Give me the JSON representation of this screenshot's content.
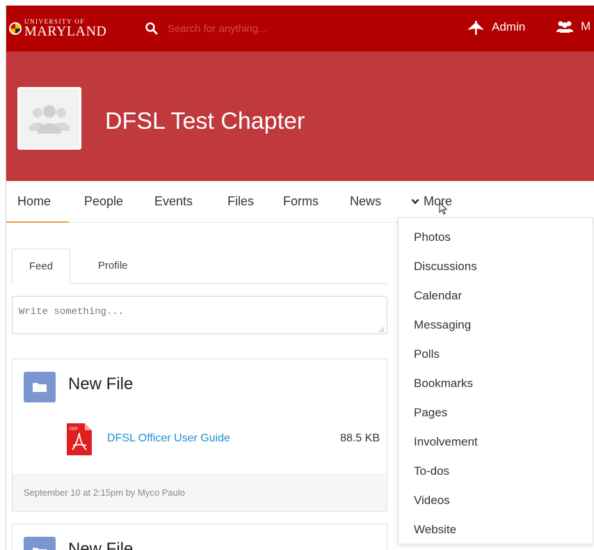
{
  "topbar": {
    "logo": {
      "line1": "UNIVERSITY OF",
      "line2": "MARYLAND"
    },
    "search_placeholder": "Search for anything...",
    "admin_label": "Admin",
    "members_label": "M",
    "bg_color": "#b30000"
  },
  "banner": {
    "title": "DFSL Test Chapter",
    "bg_color": "#c0393c"
  },
  "nav": {
    "tabs": [
      {
        "label": "Home",
        "active": true
      },
      {
        "label": "People"
      },
      {
        "label": "Events"
      },
      {
        "label": "Files"
      },
      {
        "label": "Forms"
      },
      {
        "label": "News"
      }
    ],
    "more_label": "More",
    "accent_color": "#e6a23c"
  },
  "feed": {
    "tabs": [
      {
        "label": "Feed",
        "active": true
      },
      {
        "label": "Profile"
      }
    ],
    "compose_placeholder": "Write something..."
  },
  "posts": [
    {
      "title": "New File",
      "file": {
        "name": "DFSL Officer User Guide",
        "size": "88.5 KB",
        "icon": "pdf-icon"
      },
      "meta": "September 10 at 2:15pm by Myco Paulo"
    },
    {
      "title": "New File"
    }
  ],
  "more_menu": {
    "items": [
      "Photos",
      "Discussions",
      "Calendar",
      "Messaging",
      "Polls",
      "Bookmarks",
      "Pages",
      "Involvement",
      "To-dos",
      "Videos",
      "Website"
    ]
  },
  "icons": [
    "search-icon",
    "admin-icon",
    "members-icon",
    "avatar-placeholder-icon",
    "chevron-down-icon",
    "folder-icon",
    "pdf-icon",
    "cursor-icon"
  ]
}
